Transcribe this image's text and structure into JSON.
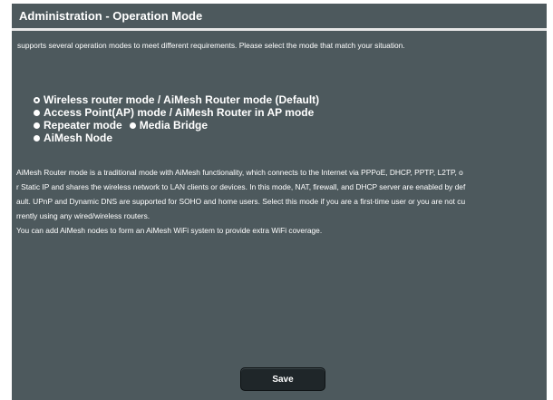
{
  "header": {
    "title": "Administration - Operation Mode"
  },
  "description": "supports several operation modes to meet different requirements. Please select the mode that match your situation.",
  "modes": {
    "selected": "Wireless router mode / AiMesh Router mode (Default)",
    "options": [
      {
        "label": "Wireless router mode / AiMesh Router mode (Default)",
        "selected": true
      },
      {
        "label": "Access Point(AP) mode / AiMesh Router in AP mode",
        "selected": false
      },
      {
        "label": "Repeater mode",
        "selected": false
      },
      {
        "label": "Media Bridge",
        "selected": false
      },
      {
        "label": "AiMesh Node",
        "selected": false
      }
    ]
  },
  "explanation": {
    "lines": [
      "AiMesh Router mode is a traditional mode with AiMesh functionality, which connects to the Internet via PPPoE, DHCP, PPTP, L2TP, o",
      "r Static IP and shares the wireless network to LAN clients or devices. In this mode, NAT, firewall, and DHCP server are enabled by def",
      "ault. UPnP and Dynamic DNS are supported for SOHO and home users. Select this mode if you are a first-time user or you are not cu",
      "rrently using any wired/wireless routers.",
      "You can add AiMesh nodes to form an AiMesh WiFi system to provide extra WiFi coverage."
    ]
  },
  "actions": {
    "save_label": "Save"
  },
  "colors": {
    "panel_background": "#4d595d",
    "button_background": "#1f2629",
    "text": "#ffffff"
  }
}
